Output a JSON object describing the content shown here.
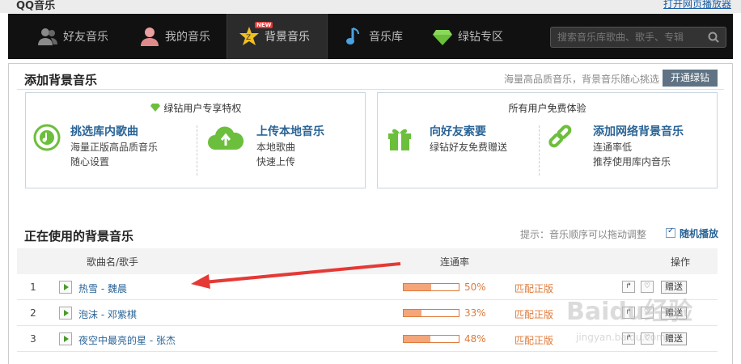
{
  "app": {
    "title": "QQ音乐",
    "open_link": "打开网页播放器"
  },
  "nav": {
    "items": [
      {
        "label": "好友音乐",
        "icon": "friends-icon"
      },
      {
        "label": "我的音乐",
        "icon": "user-icon"
      },
      {
        "label": "背景音乐",
        "icon": "background-music-icon",
        "badge": "NEW",
        "active": true
      },
      {
        "label": "音乐库",
        "icon": "music-note-icon"
      },
      {
        "label": "绿钻专区",
        "icon": "green-diamond-icon"
      }
    ],
    "search_placeholder": "搜索音乐库歌曲、歌手、专辑"
  },
  "add_section": {
    "title": "添加背景音乐",
    "hint": "海量高品质音乐，背景音乐随心挑选",
    "button": "开通绿钻",
    "vip_box": {
      "header": "绿钻用户专享特权",
      "features": [
        {
          "title": "挑选库内歌曲",
          "lines": [
            "海量正版高品质音乐",
            "随心设置"
          ],
          "icon": "music-disc-icon"
        },
        {
          "title": "上传本地音乐",
          "lines": [
            "本地歌曲",
            "快速上传"
          ],
          "icon": "cloud-upload-icon"
        }
      ]
    },
    "free_box": {
      "header": "所有用户免费体验",
      "features": [
        {
          "title": "向好友索要",
          "lines": [
            "绿钻好友免费赠送"
          ],
          "icon": "gift-icon"
        },
        {
          "title": "添加网络背景音乐",
          "lines": [
            "连通率低",
            "推荐使用库内音乐"
          ],
          "icon": "link-icon"
        }
      ]
    }
  },
  "playlist": {
    "title": "正在使用的背景音乐",
    "hint": "提示：音乐顺序可以拖动调整",
    "random_label": "随机播放",
    "random_checked": true,
    "columns": {
      "song": "歌曲名/歌手",
      "rate": "连通率",
      "ops": "操作"
    },
    "rows": [
      {
        "num": "1",
        "song": "热雪 - 魏晨",
        "rate": 50,
        "rate_label": "50%",
        "match": "匹配正版",
        "gift": "赠送"
      },
      {
        "num": "2",
        "song": "泡沫 - 邓紫棋",
        "rate": 33,
        "rate_label": "33%",
        "match": "匹配正版",
        "gift": "赠送"
      },
      {
        "num": "3",
        "song": "夜空中最亮的星 - 张杰",
        "rate": 48,
        "rate_label": "48%",
        "match": "匹配正版",
        "gift": "赠送"
      }
    ]
  },
  "watermark": {
    "main": "Baidu经验",
    "sub": "jingyan.baidu.com"
  },
  "colors": {
    "accent": "#2a6496",
    "orange": "#e07a3a",
    "green": "#6cbf3c",
    "nav_bg": "#111111",
    "arrow": "#e53935"
  }
}
